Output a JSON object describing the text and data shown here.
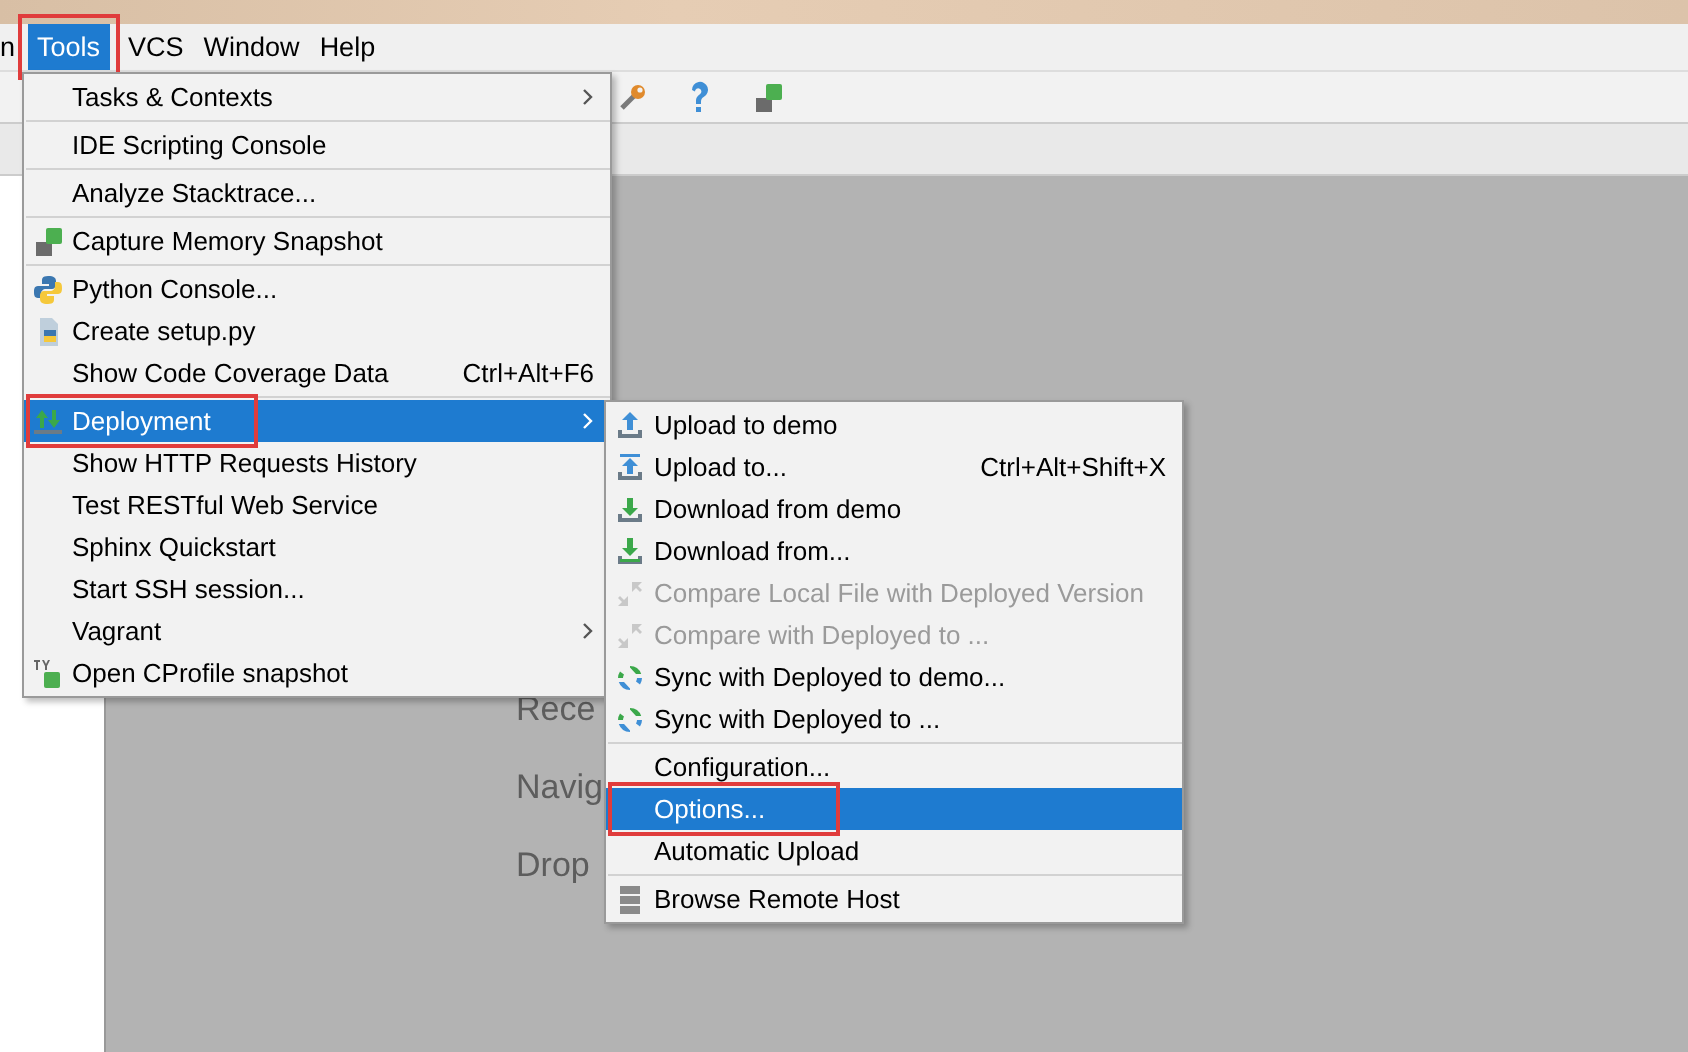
{
  "menu_bar": [
    {
      "label": "n",
      "selected": false,
      "annotated": false
    },
    {
      "label": "Tools",
      "selected": true,
      "annotated": true
    },
    {
      "label": "VCS",
      "selected": false,
      "annotated": false
    },
    {
      "label": "Window",
      "selected": false,
      "annotated": false
    },
    {
      "label": "Help",
      "selected": false,
      "annotated": false
    }
  ],
  "welcome_texts": [
    "Rece",
    "Navig",
    "Drop"
  ],
  "tools_menu": {
    "items": [
      {
        "kind": "item",
        "label": "Tasks & Contexts",
        "submenu": true,
        "selected": false,
        "annotated": false
      },
      {
        "kind": "separator"
      },
      {
        "kind": "item",
        "label": "IDE Scripting Console",
        "submenu": false,
        "selected": false,
        "annotated": false
      },
      {
        "kind": "separator"
      },
      {
        "kind": "item",
        "label": "Analyze Stacktrace...",
        "submenu": false,
        "selected": false,
        "annotated": false
      },
      {
        "kind": "separator"
      },
      {
        "kind": "item",
        "label": "Capture Memory Snapshot",
        "submenu": false,
        "selected": false,
        "annotated": false
      },
      {
        "kind": "separator"
      },
      {
        "kind": "item",
        "label": "Python Console...",
        "submenu": false,
        "selected": false,
        "annotated": false
      },
      {
        "kind": "item",
        "label": "Create setup.py",
        "submenu": false,
        "selected": false,
        "annotated": false
      },
      {
        "kind": "item",
        "label": "Show Code Coverage Data",
        "shortcut": "Ctrl+Alt+F6",
        "submenu": false,
        "selected": false,
        "annotated": false
      },
      {
        "kind": "separator"
      },
      {
        "kind": "item",
        "label": "Deployment",
        "submenu": true,
        "selected": true,
        "annotated": true
      },
      {
        "kind": "item",
        "label": "Show HTTP Requests History",
        "submenu": false,
        "selected": false,
        "annotated": false
      },
      {
        "kind": "item",
        "label": "Test RESTful Web Service",
        "submenu": false,
        "selected": false,
        "annotated": false
      },
      {
        "kind": "item",
        "label": "Sphinx Quickstart",
        "submenu": false,
        "selected": false,
        "annotated": false
      },
      {
        "kind": "item",
        "label": "Start SSH session...",
        "submenu": false,
        "selected": false,
        "annotated": false
      },
      {
        "kind": "item",
        "label": "Vagrant",
        "submenu": true,
        "selected": false,
        "annotated": false
      },
      {
        "kind": "item",
        "label": "Open CProfile snapshot",
        "submenu": false,
        "selected": false,
        "annotated": false
      }
    ]
  },
  "deployment_submenu": {
    "items": [
      {
        "kind": "item",
        "label": "Upload to demo",
        "disabled": false,
        "selected": false,
        "annotated": false
      },
      {
        "kind": "item",
        "label": "Upload to...",
        "shortcut": "Ctrl+Alt+Shift+X",
        "disabled": false,
        "selected": false,
        "annotated": false
      },
      {
        "kind": "item",
        "label": "Download from demo",
        "disabled": false,
        "selected": false,
        "annotated": false
      },
      {
        "kind": "item",
        "label": "Download from...",
        "disabled": false,
        "selected": false,
        "annotated": false
      },
      {
        "kind": "item",
        "label": "Compare Local File with Deployed Version",
        "disabled": true,
        "selected": false,
        "annotated": false
      },
      {
        "kind": "item",
        "label": "Compare with Deployed to ...",
        "disabled": true,
        "selected": false,
        "annotated": false
      },
      {
        "kind": "item",
        "label": "Sync with Deployed to demo...",
        "disabled": false,
        "selected": false,
        "annotated": false
      },
      {
        "kind": "item",
        "label": "Sync with Deployed to ...",
        "disabled": false,
        "selected": false,
        "annotated": false
      },
      {
        "kind": "separator"
      },
      {
        "kind": "item",
        "label": "Configuration...",
        "disabled": false,
        "selected": false,
        "annotated": false
      },
      {
        "kind": "item",
        "label": "Options...",
        "disabled": false,
        "selected": true,
        "annotated": true
      },
      {
        "kind": "item",
        "label": "Automatic Upload",
        "disabled": false,
        "selected": false,
        "annotated": false
      },
      {
        "kind": "separator"
      },
      {
        "kind": "item",
        "label": "Browse Remote Host",
        "disabled": false,
        "selected": false,
        "annotated": false
      }
    ]
  }
}
